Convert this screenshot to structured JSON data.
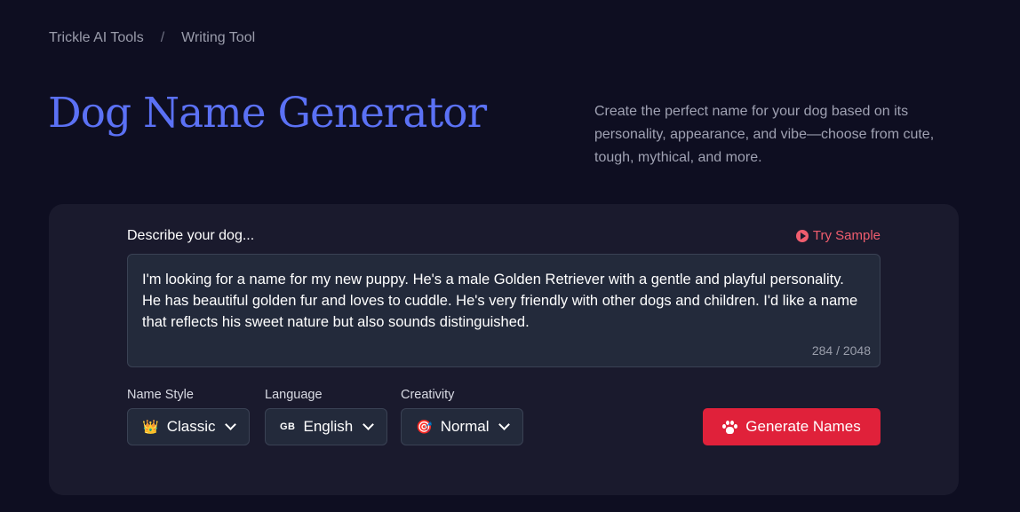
{
  "breadcrumb": {
    "root": "Trickle AI Tools",
    "separator": "/",
    "current": "Writing Tool"
  },
  "header": {
    "title": "Dog Name Generator",
    "subtitle": "Create the perfect name for your dog based on its personality, appearance, and vibe—choose from cute, tough, mythical, and more."
  },
  "form": {
    "description_label": "Describe your dog...",
    "try_sample_label": "Try Sample",
    "description_value": "I'm looking for a name for my new puppy. He's a male Golden Retriever with a gentle and playful personality. He has beautiful golden fur and loves to cuddle. He's very friendly with other dogs and children. I'd like a name that reflects his sweet nature but also sounds distinguished.",
    "char_counter": "284 / 2048",
    "name_style": {
      "label": "Name Style",
      "icon": "crown-icon",
      "glyph": "👑",
      "value": "Classic"
    },
    "language": {
      "label": "Language",
      "icon": "gb-flag-icon",
      "glyph": "GB",
      "value": "English"
    },
    "creativity": {
      "label": "Creativity",
      "icon": "target-icon",
      "glyph": "🎯",
      "value": "Normal"
    },
    "generate_label": "Generate Names"
  },
  "colors": {
    "accent_title": "#5b71f5",
    "button_red": "#e0213a",
    "sample_link": "#f05d6e",
    "background": "#0e0e21",
    "card": "#1a1a2d"
  }
}
